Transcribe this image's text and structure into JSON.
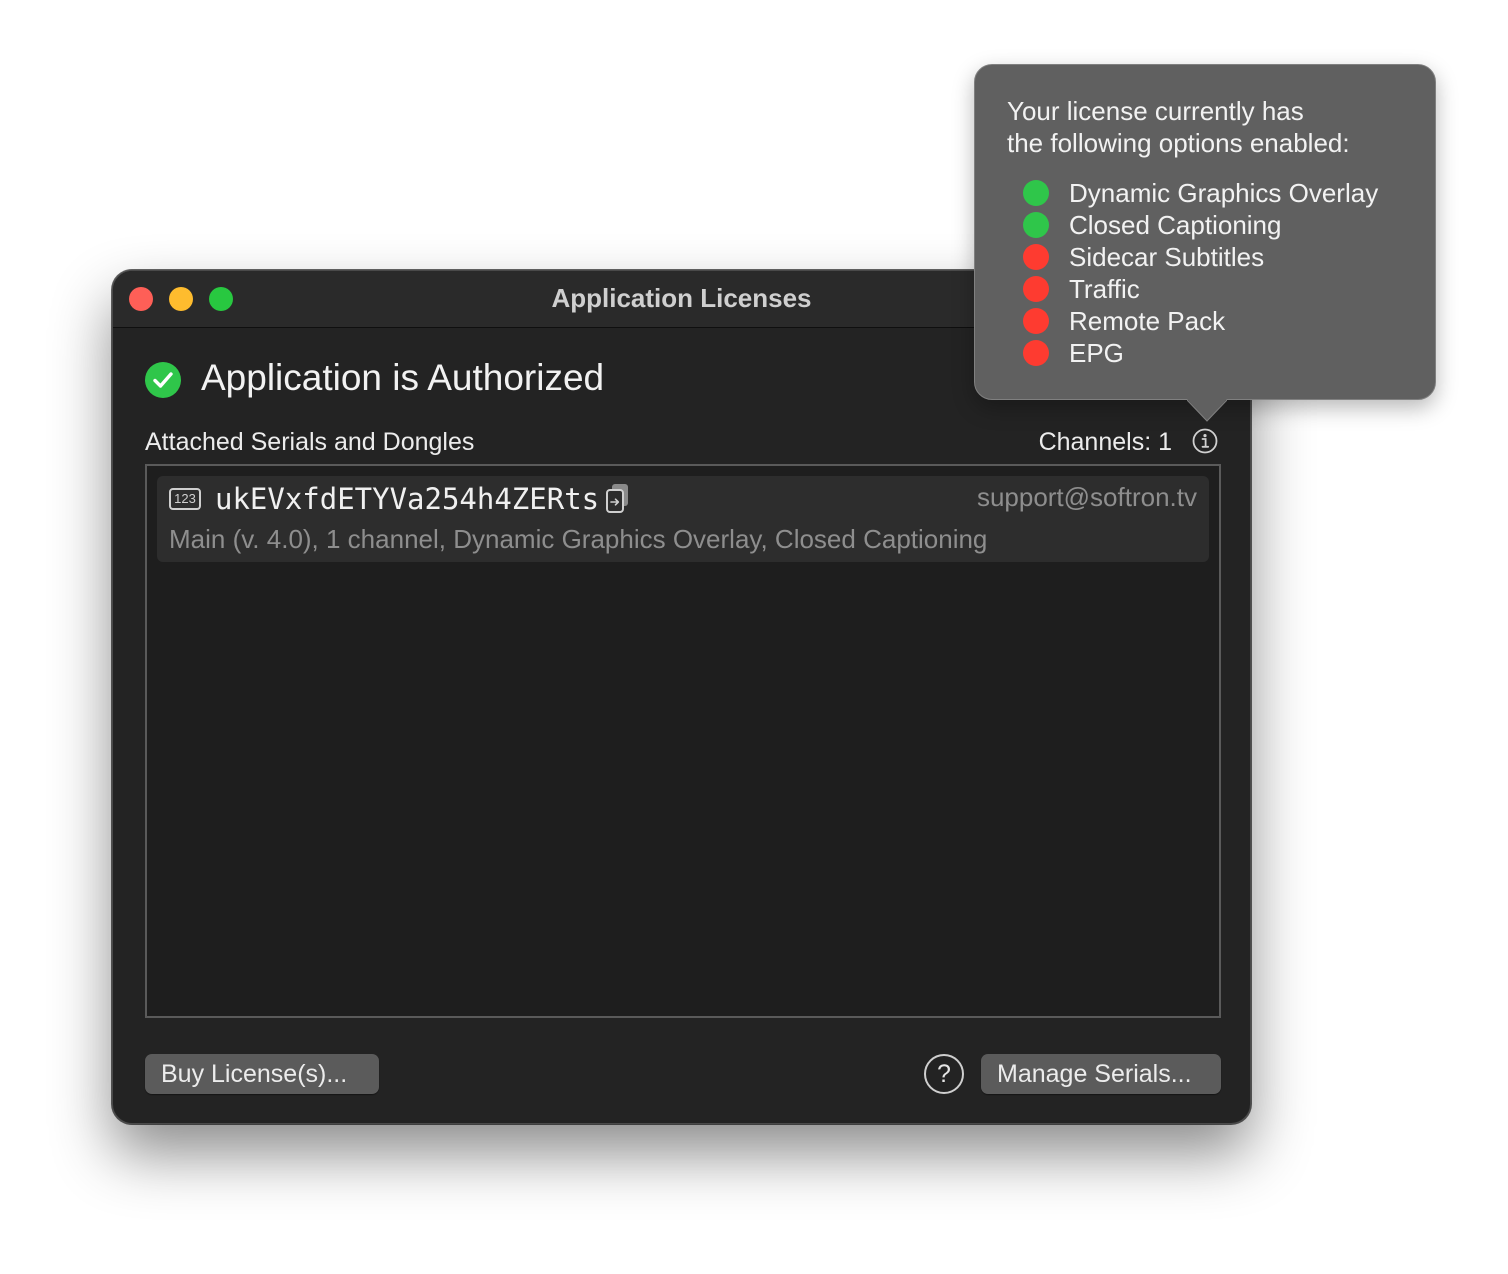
{
  "window": {
    "title": "Application Licenses"
  },
  "status": {
    "title": "Application is Authorized",
    "icon": "checkmark-circle-icon",
    "color": "#2fc64a"
  },
  "serials": {
    "section_label": "Attached Serials and Dongles",
    "channels_label": "Channels: 1",
    "items": [
      {
        "icon_text": "123",
        "serial": "ukEVxfdETYVa254h4ZERts",
        "email": "support@softron.tv",
        "description": "Main (v. 4.0), 1 channel, Dynamic Graphics Overlay, Closed Captioning"
      }
    ]
  },
  "buttons": {
    "buy": "Buy License(s)...",
    "help": "?",
    "manage": "Manage Serials..."
  },
  "popover": {
    "text": "Your license currently has the following options enabled:",
    "options": [
      {
        "label": "Dynamic Graphics Overlay",
        "enabled": true,
        "color": "#2fc64a"
      },
      {
        "label": "Closed Captioning",
        "enabled": true,
        "color": "#2fc64a"
      },
      {
        "label": "Sidecar Subtitles",
        "enabled": false,
        "color": "#fe3b30"
      },
      {
        "label": "Traffic",
        "enabled": false,
        "color": "#fe3b30"
      },
      {
        "label": "Remote Pack",
        "enabled": false,
        "color": "#fe3b30"
      },
      {
        "label": "EPG",
        "enabled": false,
        "color": "#fe3b30"
      }
    ]
  }
}
